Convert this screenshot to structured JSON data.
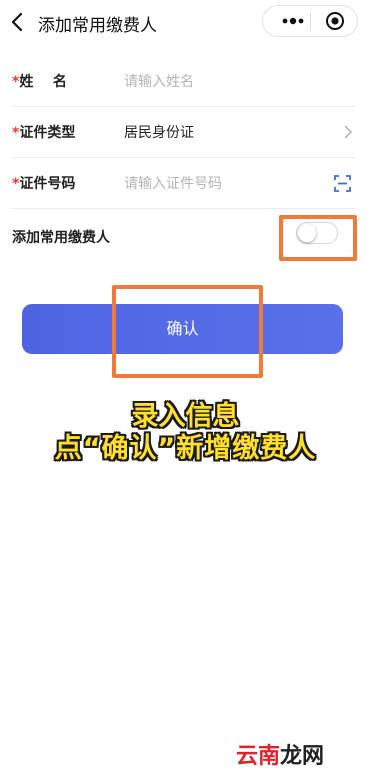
{
  "header": {
    "title": "添加常用缴费人",
    "back_icon": "chevron-left-icon",
    "more_icon": "more-dots-icon",
    "target_icon": "target-icon"
  },
  "form": {
    "name": {
      "required_mark": "*",
      "label": "姓    名",
      "placeholder": "请输入姓名"
    },
    "id_type": {
      "required_mark": "*",
      "label": "证件类型",
      "value": "居民身份证",
      "icon": "chevron-right-icon"
    },
    "id_number": {
      "required_mark": "*",
      "label": "证件号码",
      "placeholder": "请输入证件号码",
      "icon": "scan-icon"
    },
    "add_common": {
      "label": "添加常用缴费人",
      "toggle_on": false
    }
  },
  "confirm_button": {
    "label": "确认",
    "color": "#5165e6"
  },
  "caption": {
    "line1": "录入信息",
    "line2": "点“确认”新增缴费人",
    "color": "#ffdf2a"
  },
  "watermark": {
    "part1": "云南",
    "part2": "龙网"
  },
  "highlight_color": "#ef7a3a"
}
